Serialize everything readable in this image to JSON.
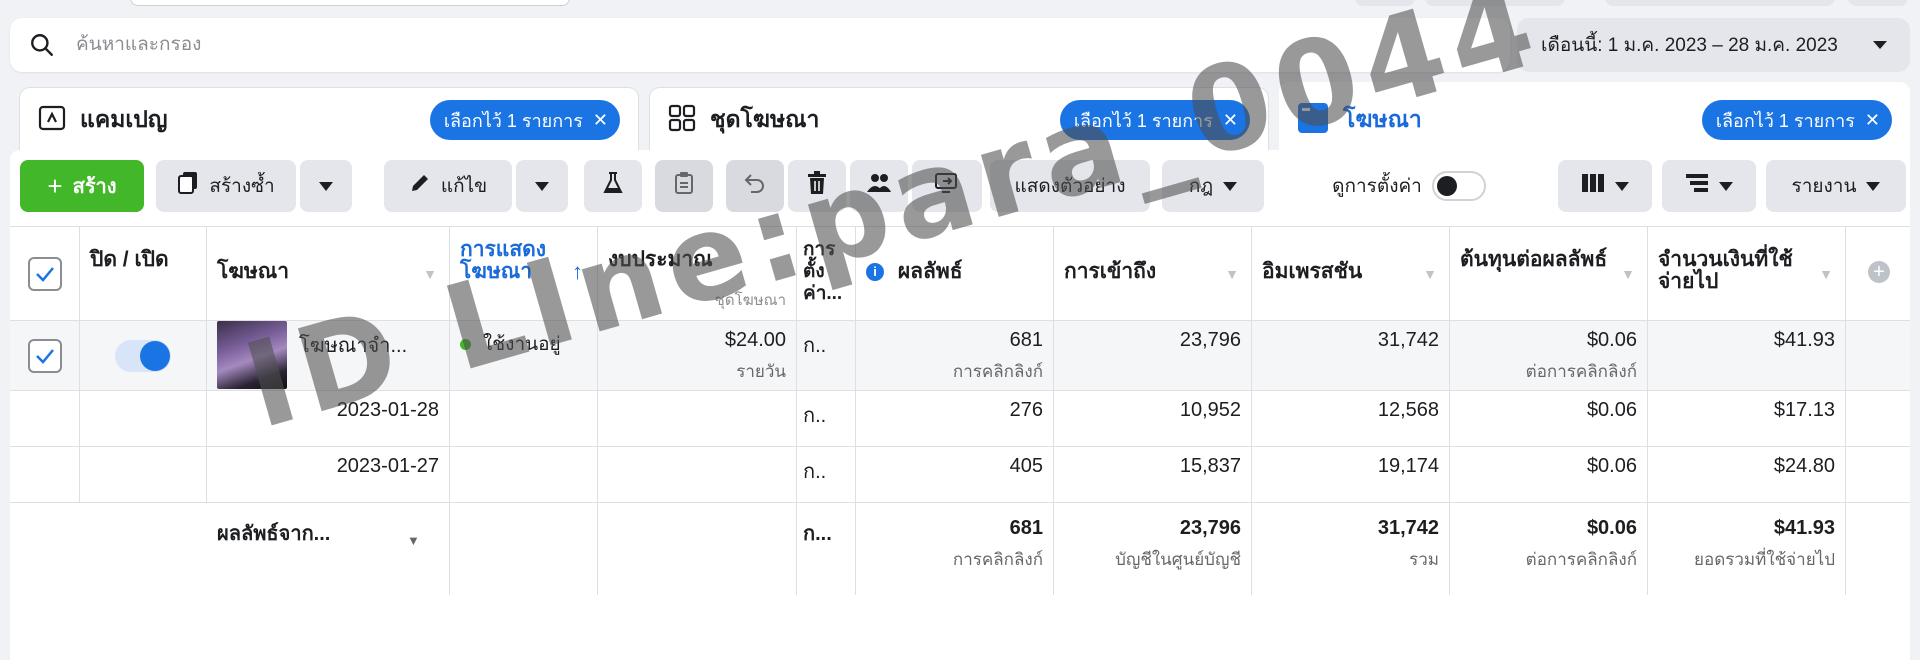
{
  "search": {
    "placeholder": "ค้นหาและกรอง"
  },
  "date_range": {
    "label": "เดือนนี้: 1 ม.ค. 2023 – 28 ม.ค. 2023"
  },
  "tabs": [
    {
      "label": "แคมเปญ",
      "chip": "เลือกไว้ 1 รายการ"
    },
    {
      "label": "ชุดโฆษณา",
      "chip": "เลือกไว้ 1 รายการ"
    },
    {
      "label": "โฆษณา",
      "chip": "เลือกไว้ 1 รายการ"
    }
  ],
  "toolbar": {
    "create": "สร้าง",
    "duplicate": "สร้างซ้ำ",
    "edit": "แก้ไข",
    "preview": "แสดงตัวอย่าง",
    "rules": "กฎ",
    "view_settings": "ดูการตั้งค่า",
    "reports": "รายงาน"
  },
  "columns": {
    "off_on": "ปิด / เปิด",
    "ad": "โฆษณา",
    "delivery": "การแสดงโฆษณา",
    "budget": "งบประมาณ",
    "budget_sub": "ชุดโฆษณา",
    "attribution": "การตั้งค่า...",
    "results": "ผลลัพธ์",
    "reach": "การเข้าถึง",
    "impressions": "อิมเพรสชัน",
    "cost_per_result": "ต้นทุนต่อผลลัพธ์",
    "amount_spent": "จำนวนเงินที่ใช้จ่ายไป"
  },
  "rows": [
    {
      "ad_name": "โฆษณาจำ...",
      "delivery": "ใช้งานอยู่",
      "budget": "$24.00",
      "budget_sub": "รายวัน",
      "attribution": "ก..",
      "results": "681",
      "results_sub": "การคลิกลิงก์",
      "reach": "23,796",
      "impressions": "31,742",
      "cost": "$0.06",
      "cost_sub": "ต่อการคลิกลิงก์",
      "spent": "$41.93"
    },
    {
      "date": "2023-01-28",
      "attribution": "ก..",
      "results": "276",
      "reach": "10,952",
      "impressions": "12,568",
      "cost": "$0.06",
      "spent": "$17.13"
    },
    {
      "date": "2023-01-27",
      "attribution": "ก..",
      "results": "405",
      "reach": "15,837",
      "impressions": "19,174",
      "cost": "$0.06",
      "spent": "$24.80"
    }
  ],
  "totals": {
    "label": "ผลลัพธ์จาก...",
    "attribution": "ก...",
    "results": "681",
    "results_sub": "การคลิกลิงก์",
    "reach": "23,796",
    "reach_sub": "บัญชีในศูนย์บัญชี",
    "impressions": "31,742",
    "impressions_sub": "รวม",
    "cost": "$0.06",
    "cost_sub": "ต่อการคลิกลิงก์",
    "spent": "$41.93",
    "spent_sub": "ยอดรวมที่ใช้จ่ายไป"
  },
  "watermark": "ID LIne:para_0044",
  "colors": {
    "accent": "#1b74e4",
    "create_green": "#42b72a",
    "active_dot": "#42b72a"
  }
}
